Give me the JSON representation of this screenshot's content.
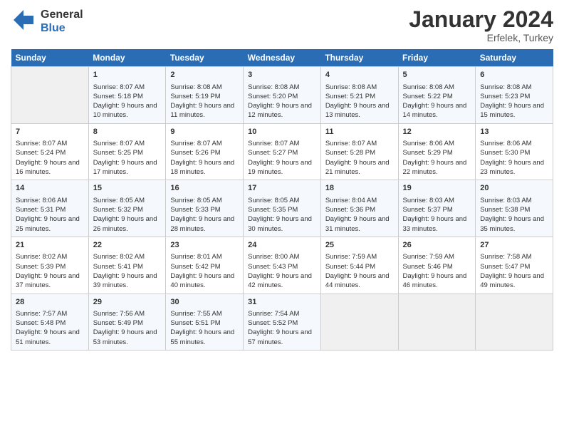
{
  "header": {
    "logo_line1": "General",
    "logo_line2": "Blue",
    "month_year": "January 2024",
    "location": "Erfelek, Turkey"
  },
  "weekdays": [
    "Sunday",
    "Monday",
    "Tuesday",
    "Wednesday",
    "Thursday",
    "Friday",
    "Saturday"
  ],
  "weeks": [
    [
      {
        "day": "",
        "info": ""
      },
      {
        "day": "1",
        "sunrise": "8:07 AM",
        "sunset": "5:18 PM",
        "daylight": "9 hours and 10 minutes."
      },
      {
        "day": "2",
        "sunrise": "8:08 AM",
        "sunset": "5:19 PM",
        "daylight": "9 hours and 11 minutes."
      },
      {
        "day": "3",
        "sunrise": "8:08 AM",
        "sunset": "5:20 PM",
        "daylight": "9 hours and 12 minutes."
      },
      {
        "day": "4",
        "sunrise": "8:08 AM",
        "sunset": "5:21 PM",
        "daylight": "9 hours and 13 minutes."
      },
      {
        "day": "5",
        "sunrise": "8:08 AM",
        "sunset": "5:22 PM",
        "daylight": "9 hours and 14 minutes."
      },
      {
        "day": "6",
        "sunrise": "8:08 AM",
        "sunset": "5:23 PM",
        "daylight": "9 hours and 15 minutes."
      }
    ],
    [
      {
        "day": "7",
        "sunrise": "8:07 AM",
        "sunset": "5:24 PM",
        "daylight": "9 hours and 16 minutes."
      },
      {
        "day": "8",
        "sunrise": "8:07 AM",
        "sunset": "5:25 PM",
        "daylight": "9 hours and 17 minutes."
      },
      {
        "day": "9",
        "sunrise": "8:07 AM",
        "sunset": "5:26 PM",
        "daylight": "9 hours and 18 minutes."
      },
      {
        "day": "10",
        "sunrise": "8:07 AM",
        "sunset": "5:27 PM",
        "daylight": "9 hours and 19 minutes."
      },
      {
        "day": "11",
        "sunrise": "8:07 AM",
        "sunset": "5:28 PM",
        "daylight": "9 hours and 21 minutes."
      },
      {
        "day": "12",
        "sunrise": "8:06 AM",
        "sunset": "5:29 PM",
        "daylight": "9 hours and 22 minutes."
      },
      {
        "day": "13",
        "sunrise": "8:06 AM",
        "sunset": "5:30 PM",
        "daylight": "9 hours and 23 minutes."
      }
    ],
    [
      {
        "day": "14",
        "sunrise": "8:06 AM",
        "sunset": "5:31 PM",
        "daylight": "9 hours and 25 minutes."
      },
      {
        "day": "15",
        "sunrise": "8:05 AM",
        "sunset": "5:32 PM",
        "daylight": "9 hours and 26 minutes."
      },
      {
        "day": "16",
        "sunrise": "8:05 AM",
        "sunset": "5:33 PM",
        "daylight": "9 hours and 28 minutes."
      },
      {
        "day": "17",
        "sunrise": "8:05 AM",
        "sunset": "5:35 PM",
        "daylight": "9 hours and 30 minutes."
      },
      {
        "day": "18",
        "sunrise": "8:04 AM",
        "sunset": "5:36 PM",
        "daylight": "9 hours and 31 minutes."
      },
      {
        "day": "19",
        "sunrise": "8:03 AM",
        "sunset": "5:37 PM",
        "daylight": "9 hours and 33 minutes."
      },
      {
        "day": "20",
        "sunrise": "8:03 AM",
        "sunset": "5:38 PM",
        "daylight": "9 hours and 35 minutes."
      }
    ],
    [
      {
        "day": "21",
        "sunrise": "8:02 AM",
        "sunset": "5:39 PM",
        "daylight": "9 hours and 37 minutes."
      },
      {
        "day": "22",
        "sunrise": "8:02 AM",
        "sunset": "5:41 PM",
        "daylight": "9 hours and 39 minutes."
      },
      {
        "day": "23",
        "sunrise": "8:01 AM",
        "sunset": "5:42 PM",
        "daylight": "9 hours and 40 minutes."
      },
      {
        "day": "24",
        "sunrise": "8:00 AM",
        "sunset": "5:43 PM",
        "daylight": "9 hours and 42 minutes."
      },
      {
        "day": "25",
        "sunrise": "7:59 AM",
        "sunset": "5:44 PM",
        "daylight": "9 hours and 44 minutes."
      },
      {
        "day": "26",
        "sunrise": "7:59 AM",
        "sunset": "5:46 PM",
        "daylight": "9 hours and 46 minutes."
      },
      {
        "day": "27",
        "sunrise": "7:58 AM",
        "sunset": "5:47 PM",
        "daylight": "9 hours and 49 minutes."
      }
    ],
    [
      {
        "day": "28",
        "sunrise": "7:57 AM",
        "sunset": "5:48 PM",
        "daylight": "9 hours and 51 minutes."
      },
      {
        "day": "29",
        "sunrise": "7:56 AM",
        "sunset": "5:49 PM",
        "daylight": "9 hours and 53 minutes."
      },
      {
        "day": "30",
        "sunrise": "7:55 AM",
        "sunset": "5:51 PM",
        "daylight": "9 hours and 55 minutes."
      },
      {
        "day": "31",
        "sunrise": "7:54 AM",
        "sunset": "5:52 PM",
        "daylight": "9 hours and 57 minutes."
      },
      {
        "day": "",
        "info": ""
      },
      {
        "day": "",
        "info": ""
      },
      {
        "day": "",
        "info": ""
      }
    ]
  ]
}
